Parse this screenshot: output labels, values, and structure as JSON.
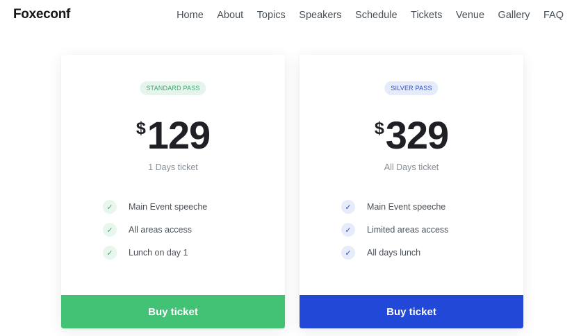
{
  "header": {
    "logo": "Foxeconf",
    "nav": [
      "Home",
      "About",
      "Topics",
      "Speakers",
      "Schedule",
      "Tickets",
      "Venue",
      "Gallery",
      "FAQ"
    ]
  },
  "tickets": [
    {
      "badge": "STANDARD PASS",
      "currency": "$",
      "price": "129",
      "duration": "1 Days ticket",
      "features": [
        "Main Event speeche",
        "All areas access",
        "Lunch on day 1"
      ],
      "button": "Buy ticket",
      "accent": "#41c274"
    },
    {
      "badge": "SILVER PASS",
      "currency": "$",
      "price": "329",
      "duration": "All Days ticket",
      "features": [
        "Main Event speeche",
        "Limited areas access",
        "All days lunch"
      ],
      "button": "Buy ticket",
      "accent": "#2148d6"
    }
  ],
  "icons": {
    "check": "check-icon"
  }
}
